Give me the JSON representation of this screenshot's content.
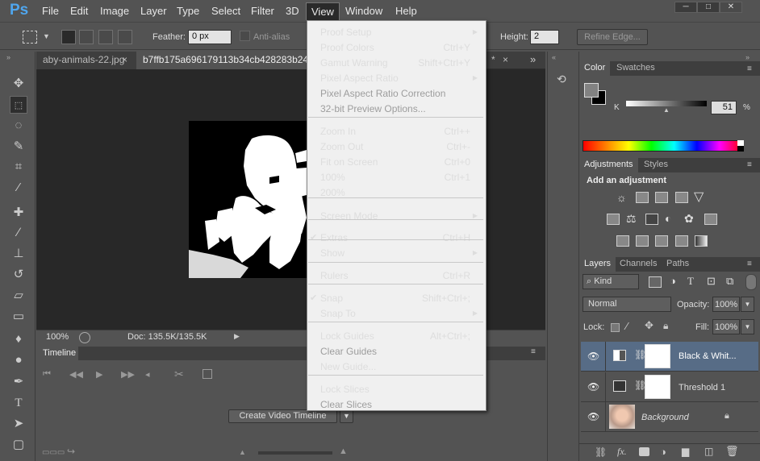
{
  "menubar": {
    "logo": "Ps",
    "items": [
      "File",
      "Edit",
      "Image",
      "Layer",
      "Type",
      "Select",
      "Filter",
      "3D",
      "View",
      "Window",
      "Help"
    ],
    "win_buttons": [
      "─",
      "□",
      "✕"
    ]
  },
  "options": {
    "feather_label": "Feather:",
    "feather_value": "0 px",
    "antialias_label": "Anti-alias",
    "height_label": "Height:",
    "height_value": "2",
    "refine_edge": "Refine Edge..."
  },
  "doc_tabs": {
    "tab1": "aby-animals-22.jpg",
    "tab1_close": "×",
    "tab2": "b7ffb175a696179113b34cb428283b24.jpg",
    "tab3_tail": "*",
    "tab3_close": "×",
    "overflow": "»"
  },
  "status": {
    "zoom": "100%",
    "doc": "Doc: 135.5K/135.5K",
    "arrow": "▶"
  },
  "timeline": {
    "title": "Timeline",
    "create_button": "Create Video Timeline"
  },
  "color_panel": {
    "tabs": [
      "Color",
      "Swatches"
    ],
    "channel": "K",
    "value": "51",
    "percent": "%"
  },
  "adjustments_panel": {
    "tabs": [
      "Adjustments",
      "Styles"
    ],
    "heading": "Add an adjustment"
  },
  "layers_panel": {
    "tabs": [
      "Layers",
      "Channels",
      "Paths"
    ],
    "filter_kind": "Kind",
    "blend_mode": "Normal",
    "opacity_label": "Opacity:",
    "opacity_value": "100%",
    "lock_label": "Lock:",
    "fill_label": "Fill:",
    "fill_value": "100%",
    "layers": [
      {
        "name": "Black & Whit...",
        "selected": true
      },
      {
        "name": "Threshold 1",
        "selected": false
      },
      {
        "name": "Background",
        "selected": false
      }
    ],
    "footer_icons": [
      "link-icon",
      "fx-icon",
      "mask-icon",
      "adjustment-icon",
      "folder-icon",
      "new-layer-icon",
      "trash-icon"
    ]
  },
  "view_menu": {
    "items": [
      {
        "label": "Proof Setup",
        "shortcut": "",
        "submenu": true,
        "disabled": false,
        "checked": false
      },
      {
        "label": "Proof Colors",
        "shortcut": "Ctrl+Y",
        "submenu": false,
        "disabled": false,
        "checked": false
      },
      {
        "label": "Gamut Warning",
        "shortcut": "Shift+Ctrl+Y",
        "submenu": false,
        "disabled": false,
        "checked": false
      },
      {
        "label": "Pixel Aspect Ratio",
        "shortcut": "",
        "submenu": true,
        "disabled": false,
        "checked": false
      },
      {
        "label": "Pixel Aspect Ratio Correction",
        "shortcut": "",
        "submenu": false,
        "disabled": true,
        "checked": false
      },
      {
        "label": "32-bit Preview Options...",
        "shortcut": "",
        "submenu": false,
        "disabled": true,
        "checked": false
      },
      {
        "label": "Zoom In",
        "shortcut": "Ctrl++",
        "submenu": false,
        "disabled": false,
        "checked": false
      },
      {
        "label": "Zoom Out",
        "shortcut": "Ctrl+-",
        "submenu": false,
        "disabled": false,
        "checked": false
      },
      {
        "label": "Fit on Screen",
        "shortcut": "Ctrl+0",
        "submenu": false,
        "disabled": false,
        "checked": false
      },
      {
        "label": "100%",
        "shortcut": "Ctrl+1",
        "submenu": false,
        "disabled": false,
        "checked": false
      },
      {
        "label": "200%",
        "shortcut": "",
        "submenu": false,
        "disabled": false,
        "checked": false
      },
      {
        "label": "Screen Mode",
        "shortcut": "",
        "submenu": true,
        "disabled": false,
        "checked": false
      },
      {
        "label": "Extras",
        "shortcut": "Ctrl+H",
        "submenu": false,
        "disabled": false,
        "checked": true
      },
      {
        "label": "Show",
        "shortcut": "",
        "submenu": true,
        "disabled": false,
        "checked": false
      },
      {
        "label": "Rulers",
        "shortcut": "Ctrl+R",
        "submenu": false,
        "disabled": false,
        "checked": false
      },
      {
        "label": "Snap",
        "shortcut": "Shift+Ctrl+;",
        "submenu": false,
        "disabled": false,
        "checked": true
      },
      {
        "label": "Snap To",
        "shortcut": "",
        "submenu": true,
        "disabled": false,
        "checked": false
      },
      {
        "label": "Lock Guides",
        "shortcut": "Alt+Ctrl+;",
        "submenu": false,
        "disabled": false,
        "checked": false
      },
      {
        "label": "Clear Guides",
        "shortcut": "",
        "submenu": false,
        "disabled": true,
        "checked": false
      },
      {
        "label": "New Guide...",
        "shortcut": "",
        "submenu": false,
        "disabled": false,
        "checked": false
      },
      {
        "label": "Lock Slices",
        "shortcut": "",
        "submenu": false,
        "disabled": false,
        "checked": false
      },
      {
        "label": "Clear Slices",
        "shortcut": "",
        "submenu": false,
        "disabled": true,
        "checked": false
      }
    ]
  }
}
